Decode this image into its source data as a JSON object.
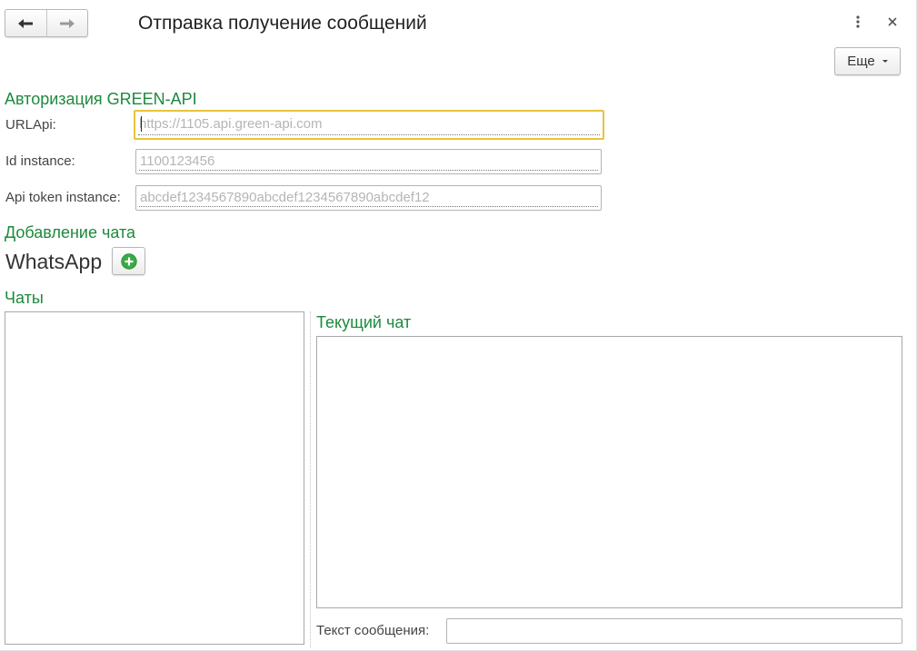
{
  "window": {
    "title": "Отправка получение сообщений"
  },
  "nav": {
    "back_icon": "arrow-left-icon",
    "forward_icon": "arrow-right-icon"
  },
  "window_controls": {
    "menu_icon": "vertical-dots-icon",
    "close_icon": "close-icon"
  },
  "toolbar": {
    "more_label": "Еще"
  },
  "auth": {
    "section_title": "Авторизация GREEN-API",
    "url_label": "URLApi:",
    "url_placeholder": "https://1105.api.green-api.com",
    "url_value": "",
    "id_label": "Id instance:",
    "id_placeholder": "1100123456",
    "id_value": "",
    "token_label": "Api token instance:",
    "token_placeholder": "abcdef1234567890abcdef1234567890abcdef12",
    "token_value": ""
  },
  "add_chat": {
    "section_title": "Добавление чата",
    "messenger_label": "WhatsApp",
    "add_icon": "plus-circle-icon"
  },
  "chats": {
    "section_title": "Чаты",
    "items": []
  },
  "current_chat": {
    "section_title": "Текущий чат",
    "messages": []
  },
  "message": {
    "label": "Текст сообщения:",
    "value": ""
  },
  "colors": {
    "section_title": "#1c8a3c",
    "focus_border": "#e8c43a",
    "add_icon": "#3aa845"
  }
}
